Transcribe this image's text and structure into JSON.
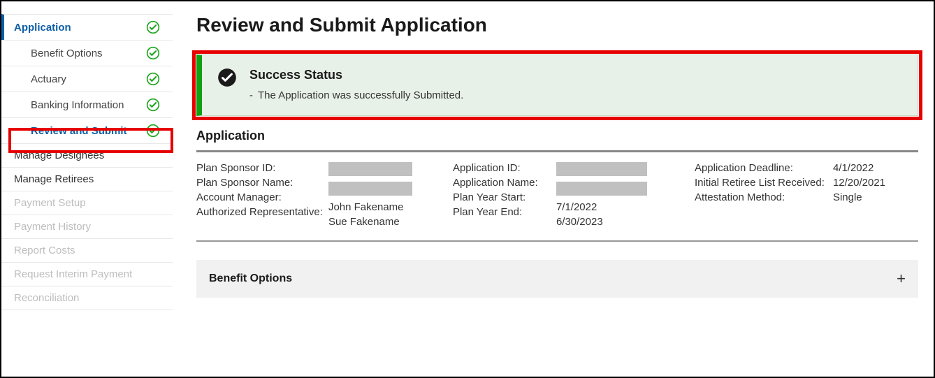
{
  "sidebar": {
    "application": "Application",
    "benefit_options": "Benefit Options",
    "actuary": "Actuary",
    "banking_information": "Banking Information",
    "review_and_submit": "Review and Submit",
    "manage_designees": "Manage Designees",
    "manage_retirees": "Manage Retirees",
    "payment_setup": "Payment Setup",
    "payment_history": "Payment History",
    "report_costs": "Report Costs",
    "request_interim_payment": "Request Interim Payment",
    "reconciliation": "Reconciliation"
  },
  "main": {
    "title": "Review and Submit Application",
    "alert": {
      "heading": "Success Status",
      "message": "The Application was successfully Submitted."
    },
    "application_section": {
      "heading": "Application",
      "fields": {
        "plan_sponsor_id_label": "Plan Sponsor ID:",
        "plan_sponsor_id_value": "",
        "plan_sponsor_name_label": "Plan Sponsor Name:",
        "plan_sponsor_name_value": "",
        "account_manager_label": "Account Manager:",
        "account_manager_value": "John Fakename",
        "authorized_rep_label": "Authorized Representative:",
        "authorized_rep_value": "Sue Fakename",
        "application_id_label": "Application ID:",
        "application_id_value": "",
        "application_name_label": "Application Name:",
        "application_name_value": "",
        "plan_year_start_label": "Plan Year Start:",
        "plan_year_start_value": "7/1/2022",
        "plan_year_end_label": "Plan Year End:",
        "plan_year_end_value": "6/30/2023",
        "application_deadline_label": "Application Deadline:",
        "application_deadline_value": "4/1/2022",
        "initial_retiree_label": "Initial Retiree List Received:",
        "initial_retiree_value": "12/20/2021",
        "attestation_method_label": "Attestation Method:",
        "attestation_method_value": "Single"
      }
    },
    "benefit_options_expander": "Benefit Options"
  }
}
